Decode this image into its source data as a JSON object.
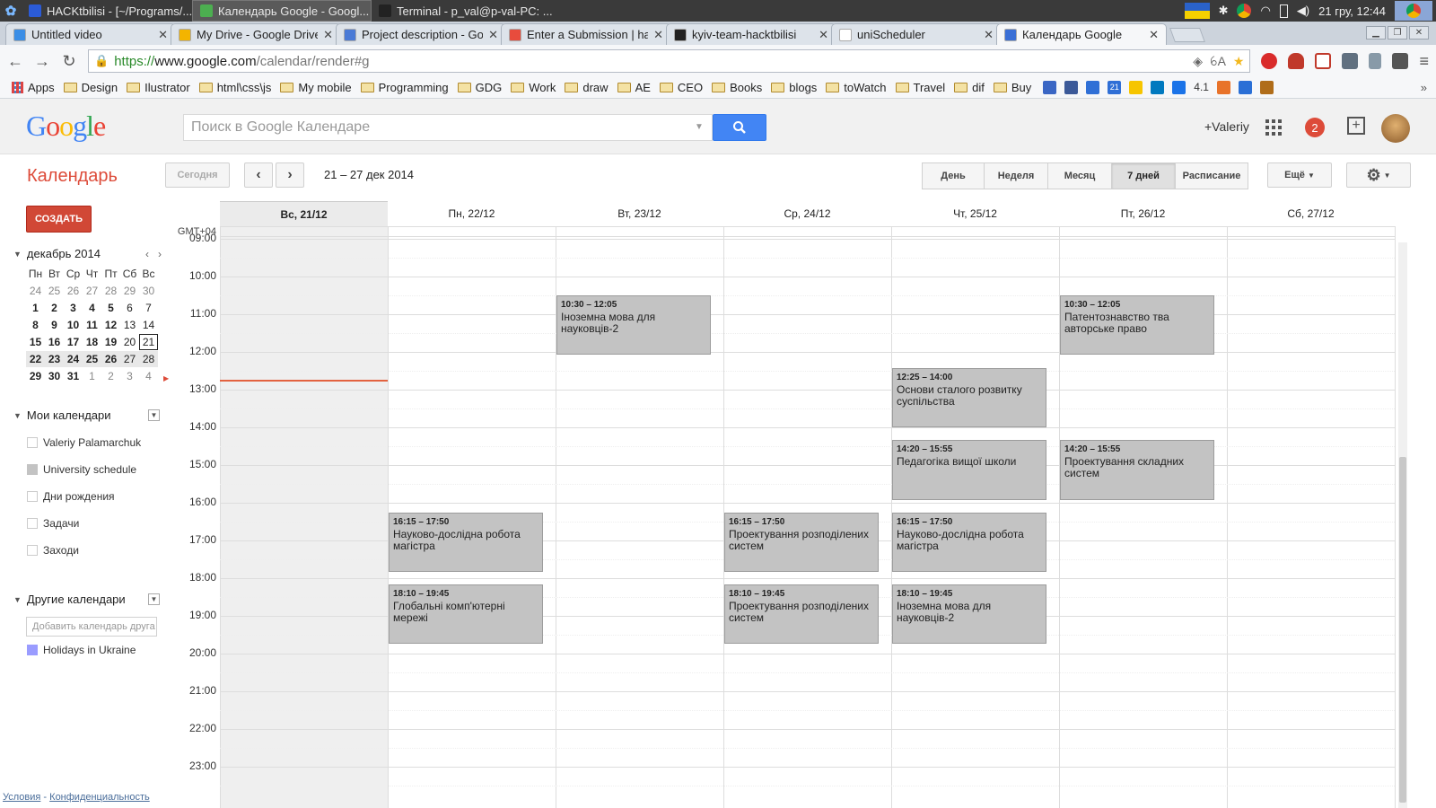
{
  "os": {
    "taskbar": [
      {
        "label": "HACKtbilisi - [~/Programs/...",
        "icon": "intellij-icon",
        "color": "#2b5bd7"
      },
      {
        "label": "Календарь Google - Googl...",
        "icon": "chrome-icon",
        "color": "#4caf50",
        "active": true
      },
      {
        "label": "Terminal - p_val@p-val-PC: ...",
        "icon": "terminal-icon",
        "color": "#222222"
      }
    ],
    "clock": "21 гру, 12:44"
  },
  "browser": {
    "tabs": [
      {
        "label": "Untitled video",
        "icon": "video-icon",
        "color": "#3a8ee6"
      },
      {
        "label": "My Drive - Google Drive",
        "icon": "drive-icon",
        "color": "#f4b400"
      },
      {
        "label": "Project description - Go",
        "icon": "docs-icon",
        "color": "#4a7ad6"
      },
      {
        "label": "Enter a Submission | ha",
        "icon": "pinwheel-icon",
        "color": "#e84c3d"
      },
      {
        "label": "kyiv-team-hacktbilisi",
        "icon": "github-icon",
        "color": "#222222"
      },
      {
        "label": "uniScheduler",
        "icon": "page-icon",
        "color": "#ffffff"
      },
      {
        "label": "Календарь Google",
        "icon": "calendar-icon",
        "color": "#3a6fd6",
        "active": true
      }
    ],
    "url": {
      "scheme": "https://",
      "host": "www.google.com",
      "path": "/calendar/render#g"
    },
    "bookmarks": [
      {
        "label": "Apps",
        "type": "apps"
      },
      {
        "label": "Design",
        "type": "folder"
      },
      {
        "label": "Ilustrator",
        "type": "folder"
      },
      {
        "label": "html\\css\\js",
        "type": "folder"
      },
      {
        "label": "My mobile",
        "type": "folder"
      },
      {
        "label": "Programming",
        "type": "folder"
      },
      {
        "label": "GDG",
        "type": "folder"
      },
      {
        "label": "Work",
        "type": "folder"
      },
      {
        "label": "draw",
        "type": "folder"
      },
      {
        "label": "AE",
        "type": "folder"
      },
      {
        "label": "CEO",
        "type": "folder"
      },
      {
        "label": "Books",
        "type": "folder"
      },
      {
        "label": "blogs",
        "type": "folder"
      },
      {
        "label": "toWatch",
        "type": "folder"
      },
      {
        "label": "Travel",
        "type": "folder"
      },
      {
        "label": "dif",
        "type": "folder"
      },
      {
        "label": "Buy",
        "type": "folder"
      }
    ],
    "bookmark_icons": [
      {
        "name": "b-icon",
        "color": "#3a66c4"
      },
      {
        "name": "facebook-icon",
        "color": "#3b5998"
      },
      {
        "name": "mail-icon",
        "color": "#2f6fd6"
      },
      {
        "name": "calendar-21-icon",
        "color": "#2f6fd6",
        "text": "21"
      },
      {
        "name": "keep-icon",
        "color": "#f6c500"
      },
      {
        "name": "trello-icon",
        "color": "#0079bf"
      },
      {
        "name": "cloud-icon",
        "color": "#1a73e8"
      },
      {
        "name": "bulb-icon",
        "color": "#ccc46a",
        "text": "4.1"
      },
      {
        "name": "u-icon",
        "color": "#e8732a"
      },
      {
        "name": "shield-icon",
        "color": "#2a6fd6"
      },
      {
        "name": "box-icon",
        "color": "#b06d1a"
      }
    ]
  },
  "header": {
    "logo": "Google",
    "search_placeholder": "Поиск в Google Календаре",
    "user": "+Valeriy",
    "notifications": "2"
  },
  "toolbar": {
    "title": "Календарь",
    "today": "Сегодня",
    "range": "21 – 27 дек 2014",
    "views": [
      {
        "label": "День",
        "w": 70
      },
      {
        "label": "Неделя",
        "w": 72
      },
      {
        "label": "Месяц",
        "w": 72
      },
      {
        "label": "7 дней",
        "w": 72,
        "active": true
      },
      {
        "label": "Расписание",
        "w": 82
      }
    ],
    "more": "Ещё"
  },
  "sidebar": {
    "create": "СОЗДАТЬ",
    "mini": {
      "month": "декабрь 2014",
      "dow": [
        "Пн",
        "Вт",
        "Ср",
        "Чт",
        "Пт",
        "Сб",
        "Вс"
      ],
      "weeks": [
        [
          "24",
          "25",
          "26",
          "27",
          "28",
          "29",
          "30"
        ],
        [
          "1",
          "2",
          "3",
          "4",
          "5",
          "6",
          "7"
        ],
        [
          "8",
          "9",
          "10",
          "11",
          "12",
          "13",
          "14"
        ],
        [
          "15",
          "16",
          "17",
          "18",
          "19",
          "20",
          "21"
        ],
        [
          "22",
          "23",
          "24",
          "25",
          "26",
          "27",
          "28"
        ],
        [
          "29",
          "30",
          "31",
          "1",
          "2",
          "3",
          "4"
        ]
      ]
    },
    "my_calendars_title": "Мои календари",
    "my_calendars": [
      {
        "label": "Valeriy Palamarchuk",
        "color": ""
      },
      {
        "label": "University schedule",
        "color": "#c3c3c3"
      },
      {
        "label": "Дни рождения",
        "color": ""
      },
      {
        "label": "Задачи",
        "color": ""
      },
      {
        "label": "Заходи",
        "color": ""
      }
    ],
    "other_calendars_title": "Другие календари",
    "add_calendar_placeholder": "Добавить календарь друга",
    "other_calendars": [
      {
        "label": "Holidays in Ukraine",
        "color": "#9a9cff"
      }
    ],
    "footer_terms": "Условия",
    "footer_sep": "-",
    "footer_privacy": "Конфиденциальность"
  },
  "grid": {
    "timezone": "GMT+04",
    "days": [
      "Вс, 21/12",
      "Пн, 22/12",
      "Вт, 23/12",
      "Ср, 24/12",
      "Чт, 25/12",
      "Пт, 26/12",
      "Сб, 27/12"
    ],
    "today_index": 0,
    "hours": [
      "09:00",
      "10:00",
      "11:00",
      "12:00",
      "13:00",
      "14:00",
      "15:00",
      "16:00",
      "17:00",
      "18:00",
      "19:00",
      "20:00",
      "21:00",
      "22:00",
      "23:00"
    ],
    "first_hour": 9,
    "now_hour": 12.73,
    "event_color": "#c3c3c3",
    "events": [
      {
        "day": 2,
        "start": 10.5,
        "end": 12.083,
        "time": "10:30 – 12:05",
        "title": "Іноземна мова для науковців-2"
      },
      {
        "day": 5,
        "start": 10.5,
        "end": 12.083,
        "time": "10:30 – 12:05",
        "title": "Патентознавство тва авторське право"
      },
      {
        "day": 4,
        "start": 12.417,
        "end": 14.0,
        "time": "12:25 – 14:00",
        "title": "Основи сталого розвитку суспільства"
      },
      {
        "day": 4,
        "start": 14.333,
        "end": 15.917,
        "time": "14:20 – 15:55",
        "title": "Педагогіка вищої школи"
      },
      {
        "day": 5,
        "start": 14.333,
        "end": 15.917,
        "time": "14:20 – 15:55",
        "title": "Проектування складних систем"
      },
      {
        "day": 1,
        "start": 16.25,
        "end": 17.833,
        "time": "16:15 – 17:50",
        "title": "Науково-дослідна робота магістра"
      },
      {
        "day": 3,
        "start": 16.25,
        "end": 17.833,
        "time": "16:15 – 17:50",
        "title": "Проектування розподілених систем"
      },
      {
        "day": 4,
        "start": 16.25,
        "end": 17.833,
        "time": "16:15 – 17:50",
        "title": "Науково-дослідна робота магістра"
      },
      {
        "day": 1,
        "start": 18.167,
        "end": 19.75,
        "time": "18:10 – 19:45",
        "title": "Глобальні комп'ютерні мережі"
      },
      {
        "day": 3,
        "start": 18.167,
        "end": 19.75,
        "time": "18:10 – 19:45",
        "title": "Проектування розподілених систем"
      },
      {
        "day": 4,
        "start": 18.167,
        "end": 19.75,
        "time": "18:10 – 19:45",
        "title": "Іноземна мова для науковців-2"
      }
    ]
  }
}
